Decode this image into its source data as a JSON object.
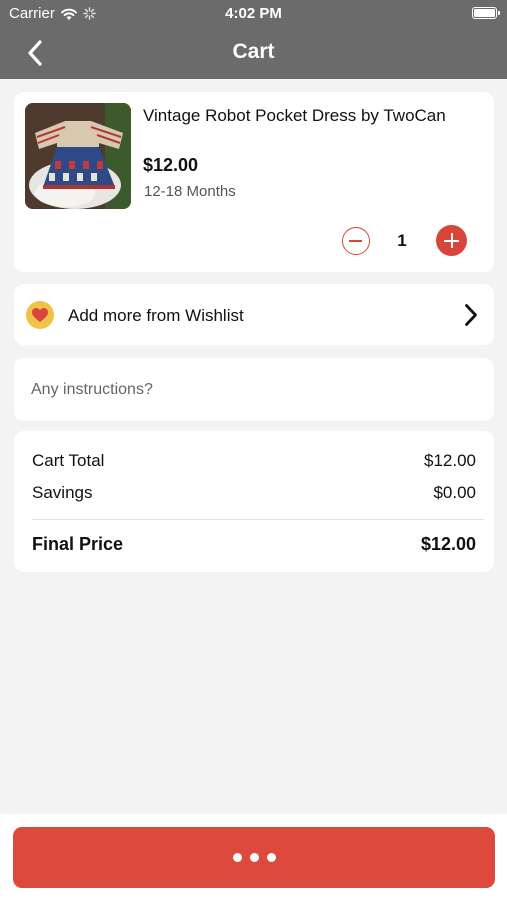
{
  "status_bar": {
    "carrier": "Carrier",
    "time": "4:02 PM"
  },
  "nav": {
    "title": "Cart"
  },
  "cart_item": {
    "name": "Vintage Robot Pocket Dress by TwoCan",
    "price": "$12.00",
    "size": "12-18 Months",
    "quantity": "1"
  },
  "wishlist": {
    "label": "Add more from Wishlist"
  },
  "instructions": {
    "placeholder": "Any instructions?"
  },
  "totals": {
    "cart_total_label": "Cart Total",
    "cart_total_value": "$12.00",
    "savings_label": "Savings",
    "savings_value": "$0.00",
    "final_label": "Final Price",
    "final_value": "$12.00"
  },
  "colors": {
    "accent": "#dd4a3d",
    "nav_bg": "#6b6b6b",
    "badge": "#f1c24a"
  }
}
